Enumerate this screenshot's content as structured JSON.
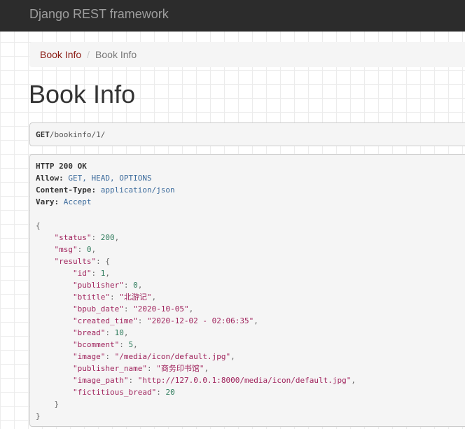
{
  "navbar": {
    "brand": "Django REST framework"
  },
  "breadcrumb": {
    "link_label": "Book Info",
    "separator": "/",
    "active_label": "Book Info"
  },
  "page": {
    "title": "Book Info"
  },
  "request": {
    "method": "GET",
    "path": "/bookinfo/1/"
  },
  "response": {
    "status_line": "HTTP 200 OK",
    "headers": [
      {
        "key": "Allow:",
        "value": "GET, HEAD, OPTIONS"
      },
      {
        "key": "Content-Type:",
        "value": "application/json"
      },
      {
        "key": "Vary:",
        "value": "Accept"
      }
    ],
    "body": {
      "open_brace": "{",
      "close_brace": "}",
      "status_key": "\"status\"",
      "status_value": "200",
      "msg_key": "\"msg\"",
      "msg_value": "0",
      "results_key": "\"results\"",
      "results_open": "{",
      "results_close": "}",
      "fields": [
        {
          "key": "\"id\"",
          "value": "1",
          "kind": "num"
        },
        {
          "key": "\"publisher\"",
          "value": "0",
          "kind": "num"
        },
        {
          "key": "\"btitle\"",
          "value": "\"北游记\"",
          "kind": "str"
        },
        {
          "key": "\"bpub_date\"",
          "value": "\"2020-10-05\"",
          "kind": "str"
        },
        {
          "key": "\"created_time\"",
          "value": "\"2020-12-02 - 02:06:35\"",
          "kind": "str"
        },
        {
          "key": "\"bread\"",
          "value": "10",
          "kind": "num"
        },
        {
          "key": "\"bcomment\"",
          "value": "5",
          "kind": "num"
        },
        {
          "key": "\"image\"",
          "value": "\"/media/icon/default.jpg\"",
          "kind": "str"
        },
        {
          "key": "\"publisher_name\"",
          "value": "\"商务印书馆\"",
          "kind": "str"
        },
        {
          "key": "\"image_path\"",
          "value": "\"http://127.0.0.1:8000/media/icon/default.jpg\"",
          "kind": "str"
        },
        {
          "key": "\"fictitious_bread\"",
          "value": "20",
          "kind": "num"
        }
      ]
    }
  },
  "colors": {
    "navbar_bg": "#2c2c2c",
    "brand_text": "#9d9d9d",
    "link_red": "#8b1d15",
    "json_key": "#a0245d",
    "json_number": "#2c7a5a",
    "header_value": "#3c6b9c"
  }
}
